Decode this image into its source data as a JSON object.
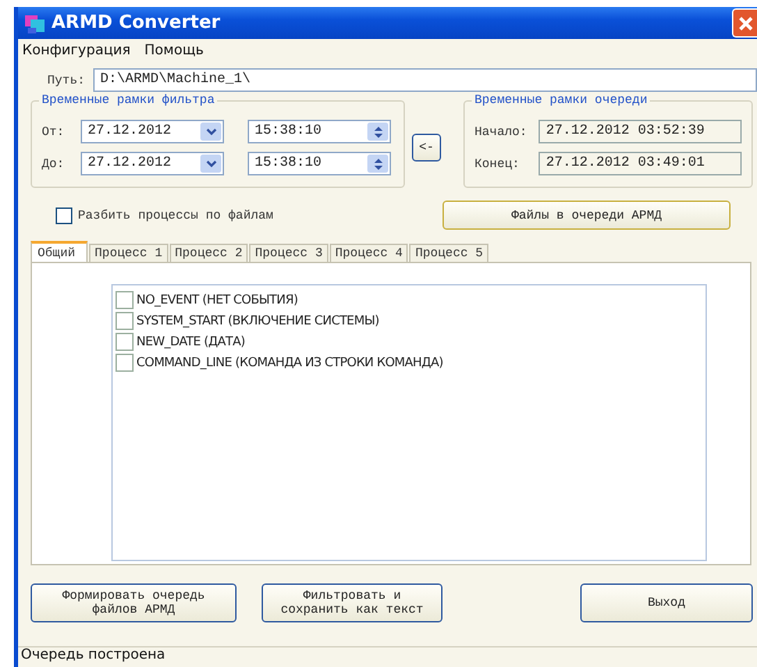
{
  "window": {
    "title": "ARMD Converter"
  },
  "menu": [
    {
      "label": "Конфигурация"
    },
    {
      "label": "Помощь"
    }
  ],
  "path": {
    "label": "Путь:",
    "value": "D:\\ARMD\\Machine_1\\"
  },
  "filter_range": {
    "title": "Временные рамки фильтра",
    "rows": [
      {
        "label": "От:",
        "date": "27.12.2012",
        "time": "15:38:10"
      },
      {
        "label": "До:",
        "date": "27.12.2012",
        "time": "15:38:10"
      }
    ]
  },
  "copy_button": "<-",
  "queue_range": {
    "title": "Временные рамки очереди",
    "rows": [
      {
        "label": "Начало:",
        "value": "27.12.2012  03:52:39"
      },
      {
        "label": "Конец:",
        "value": "27.12.2012  03:49:01"
      }
    ]
  },
  "split_checkbox": {
    "label": "Разбить процессы по файлам",
    "checked": false
  },
  "queue_files_button": "Файлы в очереди АРМД",
  "tabs": [
    {
      "label": "Общий",
      "selected": true
    },
    {
      "label": "Процесс 1",
      "selected": false
    },
    {
      "label": "Процесс 2",
      "selected": false
    },
    {
      "label": "Процесс 3",
      "selected": false
    },
    {
      "label": "Процесс 4",
      "selected": false
    },
    {
      "label": "Процесс 5",
      "selected": false
    }
  ],
  "events": [
    {
      "label": "NO_EVENT (НЕТ СОБЫТИЯ)",
      "checked": false
    },
    {
      "label": "SYSTEM_START (ВКЛЮЧЕНИЕ СИСТЕМЫ)",
      "checked": false
    },
    {
      "label": "NEW_DATE (ДАТА)",
      "checked": false
    },
    {
      "label": "COMMAND_LINE (КОМАНДА ИЗ СТРОКИ КОМАНДА)",
      "checked": false
    }
  ],
  "buttons": [
    {
      "label": "Формировать очередь\nфайлов АРМД",
      "kind": "left"
    },
    {
      "label": "Фильтровать и\nсохранить как текст",
      "kind": "left"
    },
    {
      "label": "Выход",
      "kind": "right"
    }
  ],
  "status_bar": "Очередь построена"
}
